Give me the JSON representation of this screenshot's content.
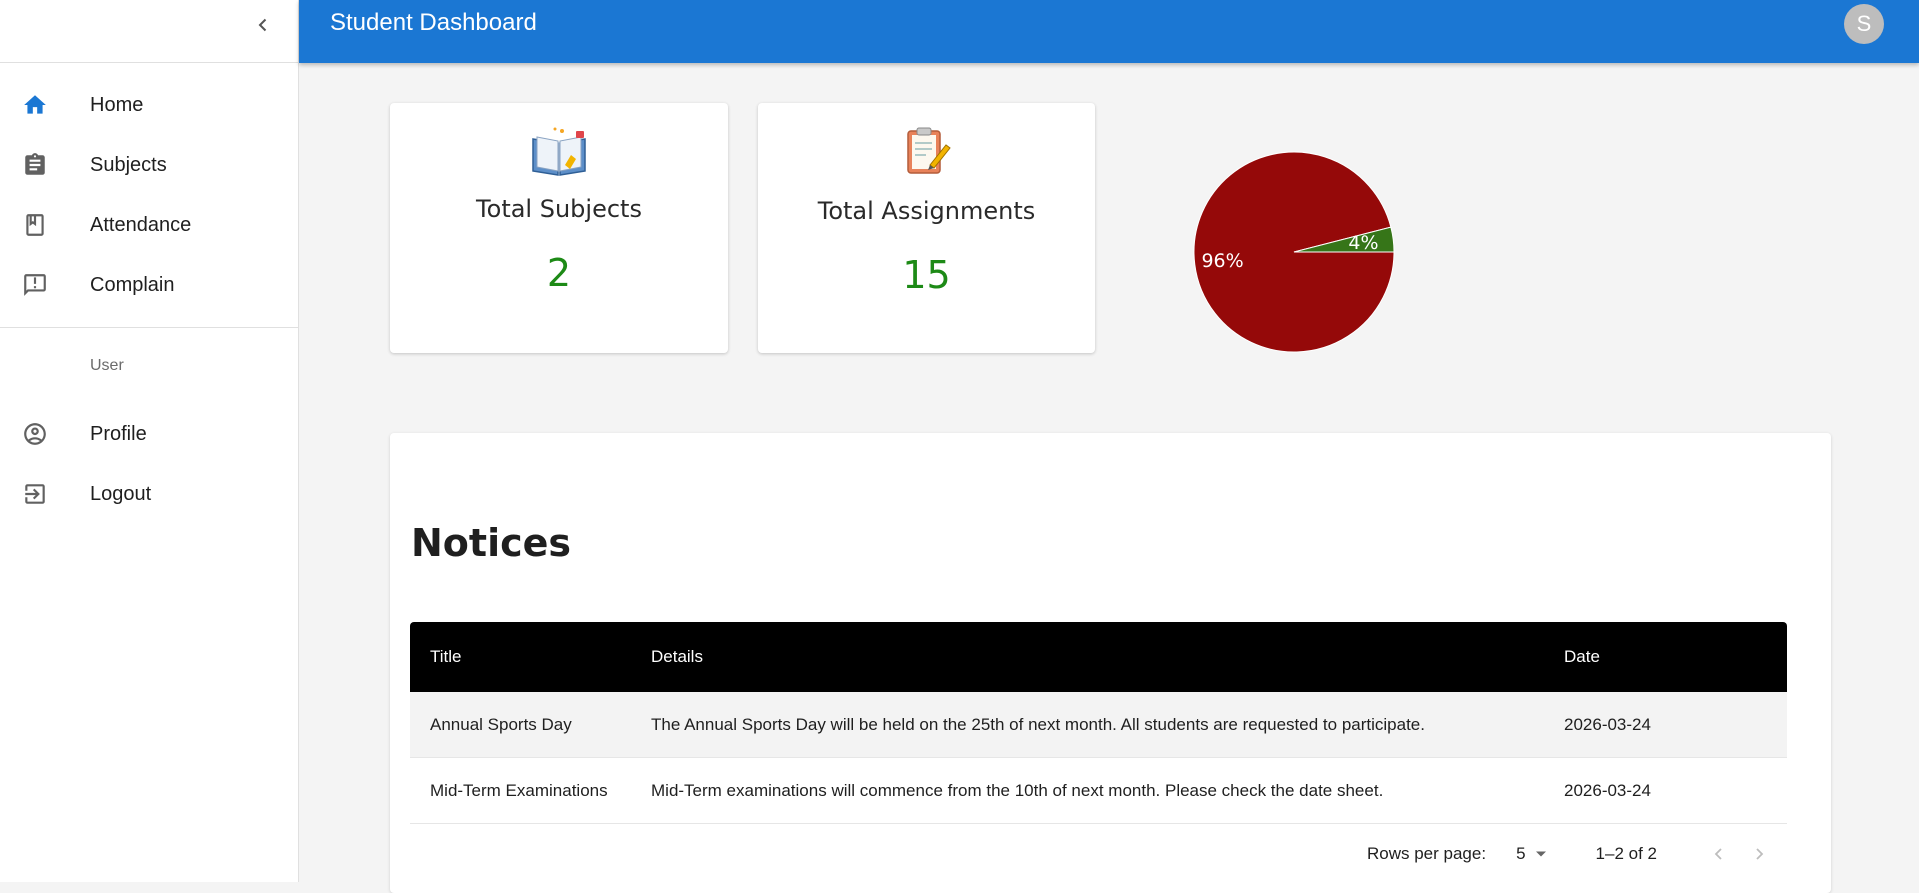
{
  "app": {
    "title": "Student Dashboard",
    "avatar_initial": "S"
  },
  "sidebar": {
    "items": [
      {
        "label": "Home",
        "icon": "home-icon",
        "active": true
      },
      {
        "label": "Subjects",
        "icon": "clipboard-icon"
      },
      {
        "label": "Attendance",
        "icon": "class-book-icon"
      },
      {
        "label": "Complain",
        "icon": "feedback-icon"
      }
    ],
    "user_section": "User",
    "user_items": [
      {
        "label": "Profile",
        "icon": "account-circle-icon"
      },
      {
        "label": "Logout",
        "icon": "logout-icon"
      }
    ]
  },
  "cards": {
    "subjects": {
      "title": "Total Subjects",
      "value": "2",
      "icon": "book-icon"
    },
    "assignments": {
      "title": "Total Assignments",
      "value": "15",
      "icon": "assignment-clipboard-icon"
    }
  },
  "pie": {
    "slices": [
      {
        "label": "96%",
        "value": 96,
        "color": "#950909"
      },
      {
        "label": "4%",
        "value": 4,
        "color": "#367518"
      }
    ]
  },
  "notices": {
    "title": "Notices",
    "columns": [
      "Title",
      "Details",
      "Date"
    ],
    "rows": [
      {
        "title": "Annual Sports Day",
        "details": "The Annual Sports Day will be held on the 25th of next month. All students are requested to participate.",
        "date": "2026-03-24"
      },
      {
        "title": "Mid-Term Examinations",
        "details": "Mid-Term examinations will commence from the 10th of next month. Please check the date sheet.",
        "date": "2026-03-24"
      }
    ],
    "pagination": {
      "rows_per_page_label": "Rows per page:",
      "rows_per_page": "5",
      "range": "1–2 of 2"
    }
  },
  "colors": {
    "appbar": "#1b77d3",
    "value_green": "#1d8a16",
    "primary": "#1b77d3"
  }
}
